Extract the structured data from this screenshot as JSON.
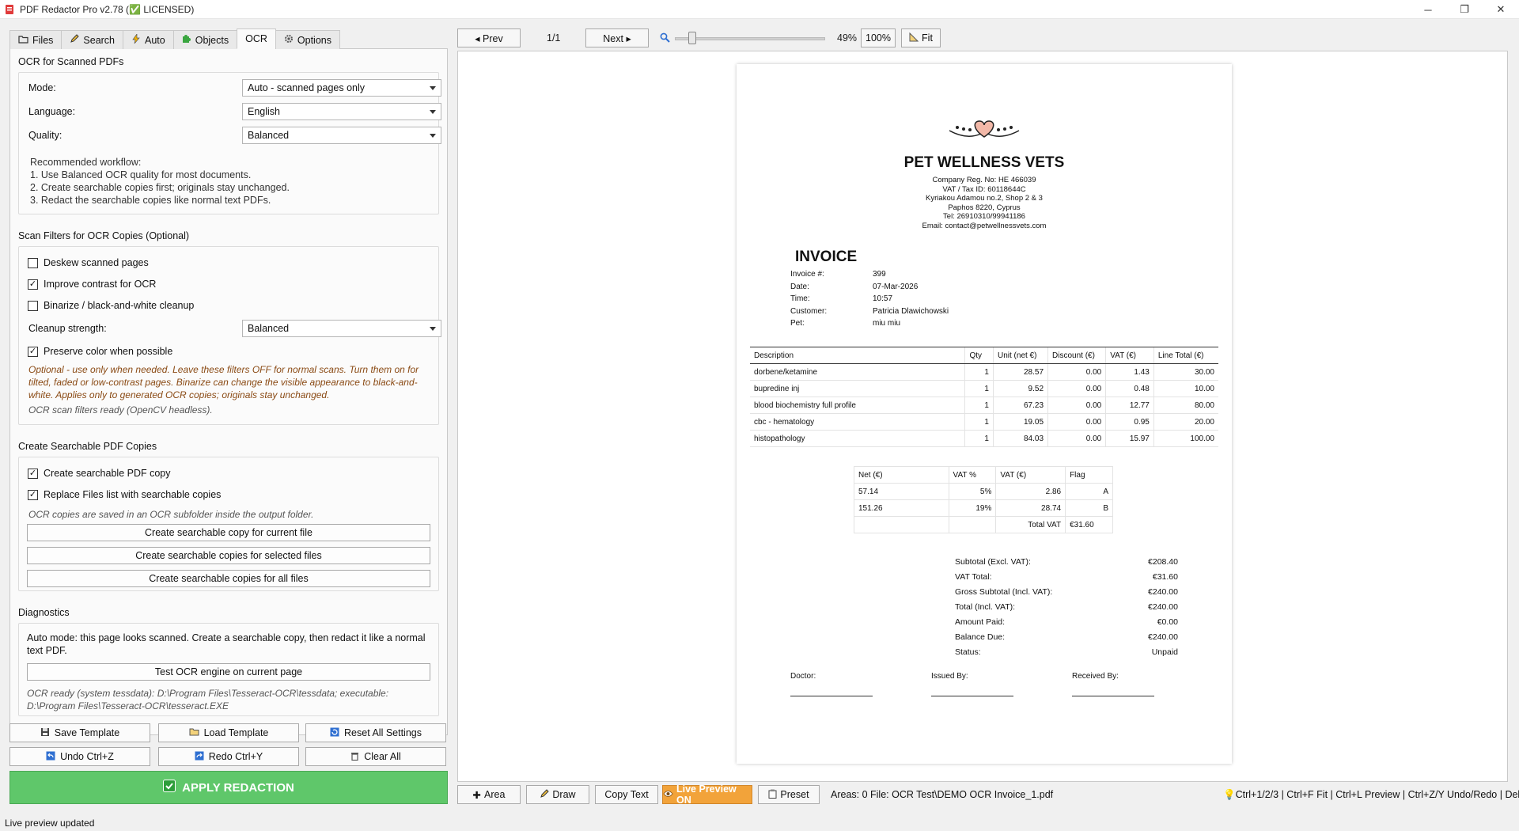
{
  "window": {
    "title": "PDF Redactor Pro v2.78 (✅ LICENSED)",
    "minimize": "─",
    "maximize": "❐",
    "close": "✕"
  },
  "tabs": [
    {
      "label": "Files",
      "icon": "folder-icon"
    },
    {
      "label": "Search",
      "icon": "pencil-icon"
    },
    {
      "label": "Auto",
      "icon": "lightning-icon"
    },
    {
      "label": "Objects",
      "icon": "puzzle-icon"
    },
    {
      "label": "OCR",
      "icon": ""
    },
    {
      "label": "Options",
      "icon": "gear-icon"
    }
  ],
  "ocr": {
    "section_title": "OCR for Scanned PDFs",
    "mode_label": "Mode:",
    "mode_value": "Auto - scanned pages only",
    "language_label": "Language:",
    "language_value": "English",
    "quality_label": "Quality:",
    "quality_value": "Balanced",
    "workflow_title": "Recommended workflow:",
    "workflow_1": "1. Use Balanced OCR quality for most documents.",
    "workflow_2": "2. Create searchable copies first; originals stay unchanged.",
    "workflow_3": "3. Redact the searchable copies like normal text PDFs."
  },
  "filters": {
    "section_title": "Scan Filters for OCR Copies (Optional)",
    "deskew": {
      "label": "Deskew scanned pages",
      "checked": false
    },
    "contrast": {
      "label": "Improve contrast for OCR",
      "checked": true
    },
    "binarize": {
      "label": "Binarize / black-and-white cleanup",
      "checked": false
    },
    "cleanup_label": "Cleanup strength:",
    "cleanup_value": "Balanced",
    "preserve": {
      "label": "Preserve color when possible",
      "checked": true
    },
    "note": "Optional - use only when needed. Leave these filters OFF for normal scans. Turn them on for tilted, faded or low-contrast pages. Binarize can change the visible appearance to black-and-white. Applies only to generated OCR copies; originals stay unchanged.",
    "status": "OCR scan filters ready (OpenCV headless)."
  },
  "searchable": {
    "section_title": "Create Searchable PDF Copies",
    "create_copy": {
      "label": "Create searchable PDF copy",
      "checked": true
    },
    "replace_list": {
      "label": "Replace Files list with searchable copies",
      "checked": true
    },
    "note": "OCR copies are saved in an OCR subfolder inside the output folder.",
    "btn_current": "Create searchable copy for current file",
    "btn_selected": "Create searchable copies for selected files",
    "btn_all": "Create searchable copies for all files"
  },
  "diagnostics": {
    "section_title": "Diagnostics",
    "text": "Auto mode: this page looks scanned. Create a searchable copy, then redact it like a normal text PDF.",
    "btn_test": "Test OCR engine on current page",
    "engine_info": "OCR ready (system tessdata): D:\\Program Files\\Tesseract-OCR\\tessdata; executable: D:\\Program Files\\Tesseract-OCR\\tesseract.EXE"
  },
  "bottom_buttons": {
    "save_template": "Save Template",
    "load_template": "Load Template",
    "reset_all": "Reset All Settings",
    "undo": "Undo  Ctrl+Z",
    "redo": "Redo  Ctrl+Y",
    "clear_all": "Clear All",
    "apply": "APPLY REDACTION"
  },
  "status_bar": "Live preview updated",
  "viewer_toolbar": {
    "prev": "◂ Prev",
    "page": "1/1",
    "next": "Next ▸",
    "zoom_percent": "49%",
    "zoom_fraction": 0.09,
    "zoom_100": "100%",
    "fit": "Fit"
  },
  "bottom_toolbar": {
    "area": "Area",
    "draw": "Draw",
    "copy_text": "Copy Text",
    "live_preview": "Live Preview ON",
    "preset": "Preset",
    "areas_info": "Areas: 0  File: OCR Test\\DEMO OCR Invoice_1.pdf",
    "shortcuts": "Ctrl+1/2/3 | Ctrl+F Fit | Ctrl+L Preview | Ctrl+Z/Y Undo/Redo | Del"
  },
  "invoice": {
    "company": "PET WELLNESS VETS",
    "address_lines": [
      "Company Reg. No: HE 466039",
      "VAT / Tax ID: 60118644C",
      "Kyriakou Adamou no.2, Shop 2 & 3",
      "Paphos 8220, Cyprus",
      "Tel: 26910310/99941186",
      "Email: contact@petwellnessvets.com"
    ],
    "heading": "INVOICE",
    "meta": [
      {
        "label": "Invoice #:",
        "value": "399"
      },
      {
        "label": "Date:",
        "value": "07-Mar-2026"
      },
      {
        "label": "Time:",
        "value": "10:57"
      },
      {
        "label": "Customer:",
        "value": "Patricia Dlawichowski"
      },
      {
        "label": "Pet:",
        "value": "miu miu"
      }
    ],
    "items_header": [
      "Description",
      "Qty",
      "Unit (net €)",
      "Discount (€)",
      "VAT (€)",
      "Line Total (€)"
    ],
    "items": [
      [
        "dorbene/ketamine",
        "1",
        "28.57",
        "0.00",
        "1.43",
        "30.00"
      ],
      [
        "bupredine inj",
        "1",
        "9.52",
        "0.00",
        "0.48",
        "10.00"
      ],
      [
        "blood biochemistry full profile",
        "1",
        "67.23",
        "0.00",
        "12.77",
        "80.00"
      ],
      [
        "cbc - hematology",
        "1",
        "19.05",
        "0.00",
        "0.95",
        "20.00"
      ],
      [
        "histopathology",
        "1",
        "84.03",
        "0.00",
        "15.97",
        "100.00"
      ]
    ],
    "vat_header": [
      "Net (€)",
      "VAT %",
      "VAT (€)",
      "Flag"
    ],
    "vat_rows": [
      [
        "57.14",
        "5%",
        "2.86",
        "A"
      ],
      [
        "151.26",
        "19%",
        "28.74",
        "B"
      ]
    ],
    "vat_total_label": "Total VAT",
    "vat_total_value": "€31.60",
    "totals": [
      {
        "label": "Subtotal (Excl. VAT):",
        "value": "€208.40"
      },
      {
        "label": "VAT Total:",
        "value": "€31.60"
      },
      {
        "label": "Gross Subtotal (Incl. VAT):",
        "value": "€240.00"
      },
      {
        "label": "Total (Incl. VAT):",
        "value": "€240.00"
      },
      {
        "label": "Amount Paid:",
        "value": "€0.00"
      },
      {
        "label": "Balance Due:",
        "value": "€240.00"
      },
      {
        "label": "Status:",
        "value": "Unpaid"
      }
    ],
    "signatures": [
      "Doctor:",
      "Issued By:",
      "Received By:"
    ]
  },
  "colors": {
    "apply_green": "#5fc76a",
    "live_orange": "#f2a33a",
    "note_brown": "#8a4a14"
  }
}
